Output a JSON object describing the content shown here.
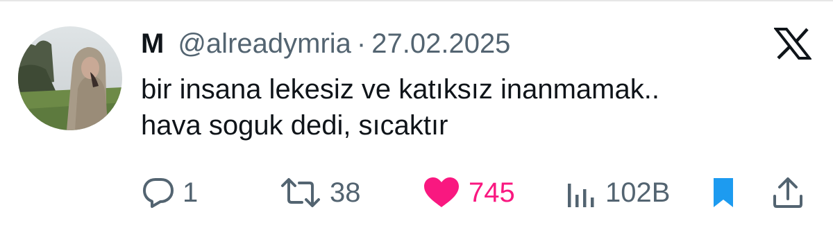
{
  "tweet": {
    "author": {
      "display_name": "M",
      "handle": "@alreadymria",
      "avatar_icon": "profile-photo"
    },
    "separator": "·",
    "date": "27.02.2025",
    "brand_icon": "x-logo-icon",
    "text_lines": [
      "bir insana lekesiz ve katıksız inanmamak..",
      "hava soguk dedi, sıcaktır"
    ],
    "metrics": {
      "replies": "1",
      "reposts": "38",
      "likes": "745",
      "views": "102B"
    },
    "state": {
      "liked": true,
      "bookmarked": true
    }
  },
  "colors": {
    "text": "#0f1419",
    "secondary": "#536471",
    "like": "#f91880",
    "bookmark": "#1d9bf0"
  }
}
